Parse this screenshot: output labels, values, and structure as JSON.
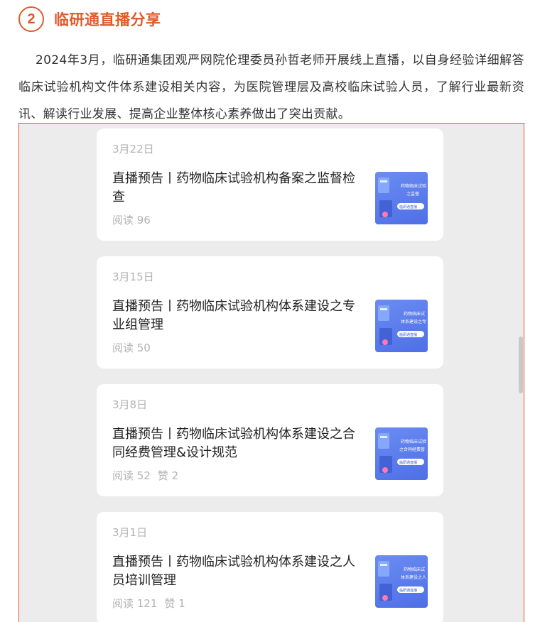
{
  "section": {
    "number": "2",
    "title": "临研通直播分享"
  },
  "intro": {
    "text": "2024年3月，临研通集团观严网院伦理委员孙哲老师开展线上直播，以自身经验详细解答临床试验机构文件体系建设相关内容，为医院管理层及高校临床试验人员，了解行业最新资讯、解读行业发展、提高企业整体核心素养做出了突出贡献。"
  },
  "colors": {
    "accent": "#e05a2b",
    "thumb": "#5a7cec"
  },
  "articles": [
    {
      "date": "3月22日",
      "title": "直播预告丨药物临床试验机构备案之监督检查",
      "reads": "阅读 96",
      "likes": "",
      "thumb_lines": [
        "药物临床试验",
        "之监督",
        "临研通直播"
      ]
    },
    {
      "date": "3月15日",
      "title": "直播预告丨药物临床试验机构体系建设之专业组管理",
      "reads": "阅读 50",
      "likes": "",
      "thumb_lines": [
        "药物临床试",
        "体系建设之专",
        "临研通直播"
      ]
    },
    {
      "date": "3月8日",
      "title": "直播预告丨药物临床试验机构体系建设之合同经费管理&设计规范",
      "reads": "阅读 52",
      "likes": "赞 2",
      "thumb_lines": [
        "药物临床试验",
        "之合同经费管",
        "临研通直播"
      ]
    },
    {
      "date": "3月1日",
      "title": "直播预告丨药物临床试验机构体系建设之人员培训管理",
      "reads": "阅读 121",
      "likes": "赞 1",
      "thumb_lines": [
        "药物临床试",
        "体系建设之人",
        "临研通直播"
      ]
    }
  ]
}
